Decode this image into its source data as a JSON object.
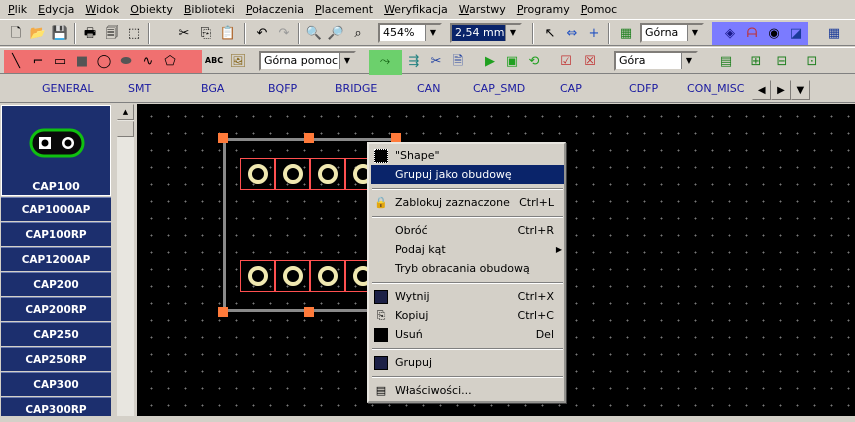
{
  "menubar": {
    "items": [
      "Plik",
      "Edycja",
      "Widok",
      "Obiekty",
      "Biblioteki",
      "Połaczenia",
      "Placement",
      "Weryfikacja",
      "Warstwy",
      "Programy",
      "Pomoc"
    ]
  },
  "toolbar1": {
    "zoom_value": "454%",
    "grid_value": "2,54 mm",
    "layer_value": "Górna"
  },
  "toolbar2": {
    "text_tool_label": "ABC",
    "helper_layer_value": "Górna pomocnic",
    "side_value": "Góra"
  },
  "library_tabs": [
    "GENERAL",
    "SMT",
    "BGA",
    "BQFP",
    "BRIDGE",
    "CAN",
    "CAP_SMD",
    "CAP",
    "CDFP",
    "CON_MISC"
  ],
  "left_panel": {
    "preview_label": "CAP100",
    "items": [
      "CAP1000AP",
      "CAP100RP",
      "CAP1200AP",
      "CAP200",
      "CAP200RP",
      "CAP250",
      "CAP250RP",
      "CAP300",
      "CAP300RP"
    ]
  },
  "context_menu": {
    "items": [
      {
        "label": "\"Shape\"",
        "shortcut": ""
      },
      {
        "label": "Grupuj jako obudowę",
        "shortcut": ""
      },
      {
        "label": "Zablokuj zaznaczone",
        "shortcut": "Ctrl+L"
      },
      {
        "label": "Obróć",
        "shortcut": "Ctrl+R"
      },
      {
        "label": "Podaj kąt",
        "shortcut": "▶"
      },
      {
        "label": "Tryb obracania obudową",
        "shortcut": ""
      },
      {
        "label": "Wytnij",
        "shortcut": "Ctrl+X"
      },
      {
        "label": "Kopiuj",
        "shortcut": "Ctrl+C"
      },
      {
        "label": "Usuń",
        "shortcut": "Del"
      },
      {
        "label": "Grupuj",
        "shortcut": ""
      },
      {
        "label": "Właściwości...",
        "shortcut": ""
      }
    ]
  },
  "colors": {
    "canvas_bg": "#000000",
    "pad_outline": "#ff5050",
    "pad_ring": "#f0e8b0",
    "handle": "#ff7a3a",
    "panel_item_bg": "#1c2f6e",
    "menu_highlight": "#0a246a"
  }
}
